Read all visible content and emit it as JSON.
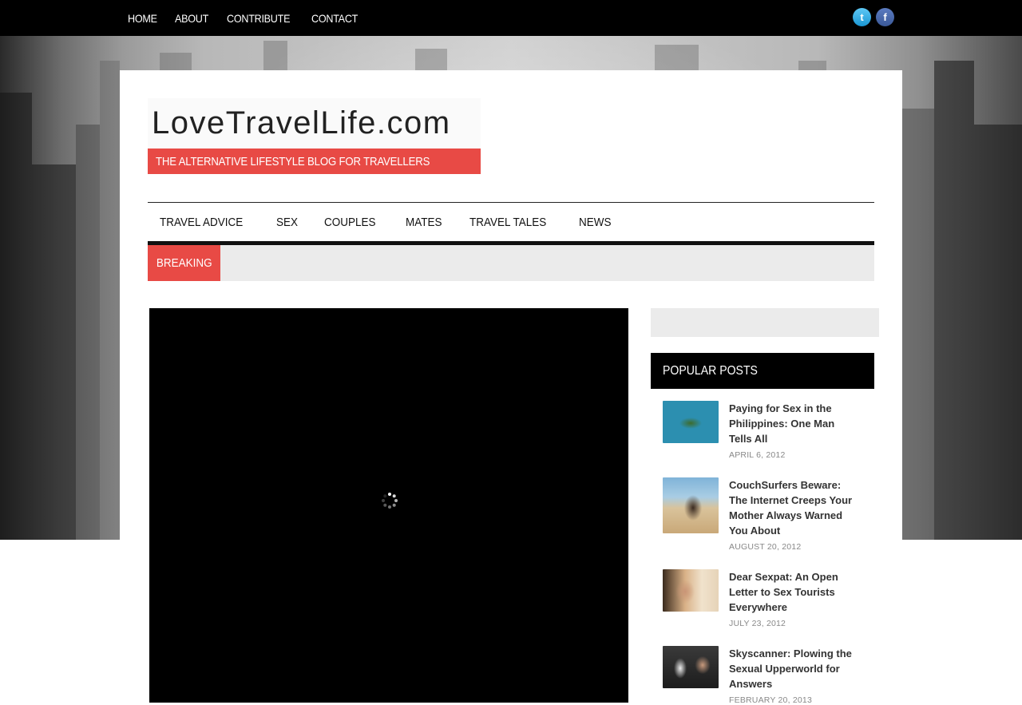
{
  "top_nav": [
    "HOME",
    "ABOUT",
    "CONTRIBUTE",
    "CONTACT"
  ],
  "social": {
    "twitter_icon": "t",
    "facebook_icon": "f"
  },
  "logo": {
    "site_name": "LoveTravelLife.com",
    "tagline": "THE ALTERNATIVE LIFESTYLE BLOG FOR TRAVELLERS"
  },
  "main_nav": [
    "TRAVEL ADVICE",
    "SEX",
    "COUPLES",
    "MATES",
    "TRAVEL TALES",
    "NEWS"
  ],
  "breaking": {
    "label": "BREAKING"
  },
  "sidebar": {
    "popular_title": "POPULAR POSTS",
    "posts": [
      {
        "title": "Paying for Sex in the Philippines: One Man Tells All",
        "date": "APRIL 6, 2012"
      },
      {
        "title": "CouchSurfers Beware: The Internet Creeps Your Mother Always Warned You About",
        "date": "AUGUST 20, 2012"
      },
      {
        "title": "Dear Sexpat: An Open Letter to Sex Tourists Everywhere",
        "date": "JULY 23, 2012"
      },
      {
        "title": "Skyscanner: Plowing the Sexual Upperworld for Answers",
        "date": "FEBRUARY 20, 2013"
      }
    ]
  },
  "colors": {
    "accent": "#e84a45",
    "topbar": "#000000",
    "breaking_bg": "#ebebeb"
  }
}
